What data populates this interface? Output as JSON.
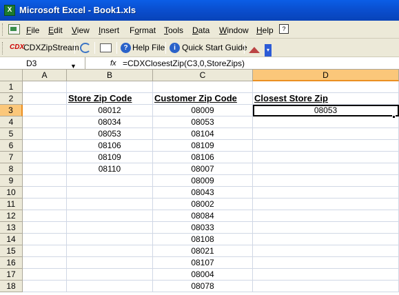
{
  "window": {
    "icon_label": "X",
    "title": "Microsoft Excel - Book1.xls"
  },
  "menubar": {
    "items": [
      {
        "label": "File",
        "key": "F"
      },
      {
        "label": "Edit",
        "key": "E"
      },
      {
        "label": "View",
        "key": "V"
      },
      {
        "label": "Insert",
        "key": "I"
      },
      {
        "label": "Format",
        "key": "o"
      },
      {
        "label": "Tools",
        "key": "T"
      },
      {
        "label": "Data",
        "key": "D"
      },
      {
        "label": "Window",
        "key": "W"
      },
      {
        "label": "Help",
        "key": "H"
      }
    ],
    "help_icon": "book-help-icon"
  },
  "toolbar": {
    "cdx_label": "CDXZipStream",
    "help_file_label": "Help File",
    "quick_start_label": "Quick Start Guide",
    "icons": [
      "cdx-icon",
      "refresh-icon",
      "card-icon",
      "help-icon",
      "info-icon",
      "home-icon",
      "chevron-icon"
    ]
  },
  "formula_bar": {
    "name_box": "D3",
    "fx_label": "fx",
    "formula": "=CDXClosestZip(C3,0,StoreZips)"
  },
  "sheet": {
    "columns": [
      "A",
      "B",
      "C",
      "D"
    ],
    "selected_column": "D",
    "rows": [
      "1",
      "2",
      "3",
      "4",
      "5",
      "6",
      "7",
      "8",
      "9",
      "10",
      "11",
      "12",
      "13",
      "14",
      "15",
      "16",
      "17",
      "18"
    ],
    "selected_row": "3",
    "headers": {
      "store": "Store Zip Code",
      "customer": "Customer Zip Code",
      "closest": "Closest Store Zip"
    },
    "store_zips": [
      "08012",
      "08034",
      "08053",
      "08106",
      "08109",
      "08110"
    ],
    "customer_zips": [
      "08009",
      "08053",
      "08104",
      "08109",
      "08106",
      "08007",
      "08009",
      "08043",
      "08002",
      "08084",
      "08033",
      "08108",
      "08021",
      "08107",
      "08004",
      "08078"
    ],
    "closest_zips": [
      "08053"
    ]
  }
}
